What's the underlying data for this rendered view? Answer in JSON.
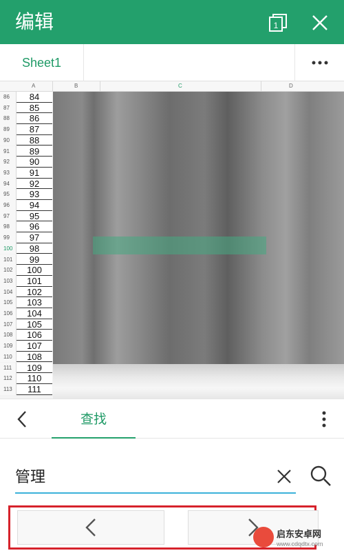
{
  "header": {
    "title": "编辑",
    "window_count": "1"
  },
  "tabs": {
    "sheet_name": "Sheet1",
    "more": "•••"
  },
  "grid": {
    "columns": [
      "A",
      "B",
      "C",
      "D"
    ],
    "active_row": "100",
    "rows": [
      {
        "n": "86",
        "a": "84"
      },
      {
        "n": "87",
        "a": "85"
      },
      {
        "n": "88",
        "a": "86"
      },
      {
        "n": "89",
        "a": "87"
      },
      {
        "n": "90",
        "a": "88"
      },
      {
        "n": "91",
        "a": "89"
      },
      {
        "n": "92",
        "a": "90"
      },
      {
        "n": "93",
        "a": "91"
      },
      {
        "n": "94",
        "a": "92"
      },
      {
        "n": "95",
        "a": "93"
      },
      {
        "n": "96",
        "a": "94"
      },
      {
        "n": "97",
        "a": "95"
      },
      {
        "n": "98",
        "a": "96"
      },
      {
        "n": "99",
        "a": "97"
      },
      {
        "n": "100",
        "a": "98"
      },
      {
        "n": "101",
        "a": "99"
      },
      {
        "n": "102",
        "a": "100"
      },
      {
        "n": "103",
        "a": "101"
      },
      {
        "n": "104",
        "a": "102"
      },
      {
        "n": "105",
        "a": "103"
      },
      {
        "n": "106",
        "a": "104"
      },
      {
        "n": "107",
        "a": "105"
      },
      {
        "n": "108",
        "a": "106"
      },
      {
        "n": "109",
        "a": "107"
      },
      {
        "n": "110",
        "a": "108"
      },
      {
        "n": "111",
        "a": "109"
      },
      {
        "n": "112",
        "a": "110"
      },
      {
        "n": "113",
        "a": "111"
      }
    ]
  },
  "findbar": {
    "tab_label": "查找"
  },
  "search": {
    "value": "管理"
  },
  "watermark": {
    "name": "启东安卓网",
    "url": "www.cdqdtx.com"
  },
  "colors": {
    "brand": "#23a06c",
    "highlight_border": "#d6222b",
    "input_underline": "#3ab1d9"
  }
}
